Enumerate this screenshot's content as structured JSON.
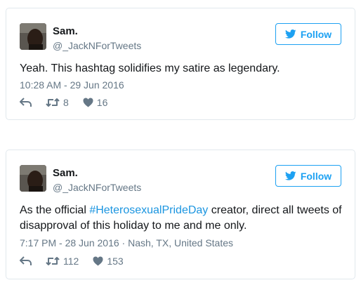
{
  "tweets": [
    {
      "name": "Sam.",
      "handle": "@_JackNForTweets",
      "follow_label": "Follow",
      "text_before": "Yeah. This hashtag solidifies my satire as legendary.",
      "hashtag": "",
      "text_after": "",
      "timestamp": "10:28 AM - 29 Jun 2016",
      "retweets": "8",
      "likes": "16"
    },
    {
      "name": "Sam.",
      "handle": "@_JackNForTweets",
      "follow_label": "Follow",
      "text_before": "As the official ",
      "hashtag": "#HeterosexualPrideDay",
      "text_after": " creator, direct all tweets of disapproval of this holiday to me and me only.",
      "timestamp": "7:17 PM - 28 Jun 2016 · Nash, TX, United States",
      "retweets": "112",
      "likes": "153"
    }
  ],
  "colors": {
    "accent": "#1da1f2",
    "hashtag": "#1b95e0",
    "muted": "#657786",
    "border": "#e1e8ed"
  },
  "icons": [
    "bird-icon",
    "reply-icon",
    "retweet-icon",
    "heart-icon"
  ]
}
